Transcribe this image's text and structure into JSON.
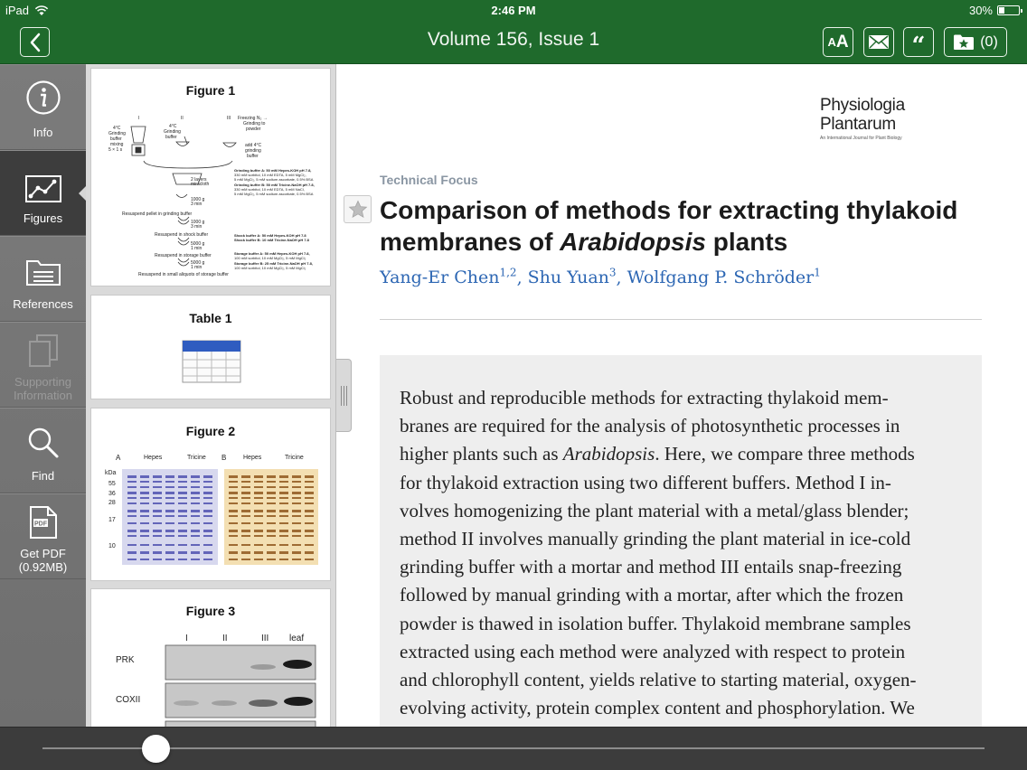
{
  "status_bar": {
    "device": "iPad",
    "time": "2:46 PM",
    "battery": "30%",
    "battery_level": 0.3
  },
  "nav": {
    "title": "Volume 156, Issue 1",
    "text_size_label_small": "A",
    "text_size_label_big": "A",
    "quote_label": "“",
    "saved_count": "(0)",
    "icons": {
      "back": "chevron-left-icon",
      "mail": "mail-icon",
      "saved": "folder-star-icon"
    }
  },
  "sidebar": {
    "items": [
      {
        "label": "Info",
        "icon": "info-icon"
      },
      {
        "label": "Figures",
        "icon": "figures-icon",
        "active": true
      },
      {
        "label": "References",
        "icon": "references-folder-icon"
      },
      {
        "label": "Supporting\nInformation",
        "icon": "supporting-docs-icon",
        "disabled": true
      },
      {
        "label": "Find",
        "icon": "search-icon"
      },
      {
        "label": "Get PDF\n(0.92MB)",
        "icon": "pdf-icon"
      }
    ]
  },
  "thumbnails": [
    {
      "title": "Figure 1",
      "labels": {
        "step1": "I",
        "step2": "II",
        "step3": "III",
        "c1": "4°C",
        "grind1": "Grinding",
        "buffer1": "buffer",
        "mixing": "mixing",
        "time": "5 × 1 s",
        "c2": "4°C",
        "grind2": "Grinding",
        "buffer2": "buffer",
        "freeze": "Freezing N₂ →",
        "grind_to": "Grinding to",
        "powder": "powder",
        "add": "add 4°C",
        "grind3": "grinding",
        "buffer3": "buffer",
        "layers": "2 layers",
        "miracloth": "miracloth",
        "g1000a": "1000 g",
        "min3a": "3 min",
        "resuspend1": "Resuspend pellet in grinding buffer",
        "g1000b": "1000 g",
        "min3b": "3 min",
        "resuspend2": "Resuspend in shock buffer",
        "g5000a": "5000 g",
        "min1a": "1 min",
        "resuspend3": "Resuspend in storage buffer",
        "g5000b": "5000 g",
        "min1b": "1 min",
        "resuspend4": "Resuspend in small aliquots of storage buffer",
        "gb_a": "Grinding buffer A: 50 mM Hepes-KOH pH 7.8,",
        "gb_a2": "330 mM sorbitol, 10 mM EDTA, 5 mM MgCl₂,",
        "gb_a3": "5 mM MgCl₂, 5 mM sodium ascorbate, 0.5% BSA",
        "gb_b": "Grinding buffer B: 50 mM Tricine-NaOH pH 7.8,",
        "gb_b2": "330 mM sorbitol, 10 mM EDTA, 5 mM NaCl,",
        "gb_b3": "5 mM MgCl₂, 5 mM sodium ascorbate, 0.5% BSA",
        "sb_a": "Shock buffer A: 50 mM Hepes-KOH pH 7.8",
        "sb_b": "Shock buffer B: 10 mM Tricine-NaOH pH 7.8",
        "st_a": "Storage buffer A: 50 mM Hepes-KOH pH 7.8,",
        "st_a2": "100 mM sorbitol, 10 mM MgCl₂, 5 mM MgCl₂",
        "st_b": "Storage buffer B: 25 mM Tricine-NaOH pH 7.8,",
        "st_b2": "100 mM sorbitol, 10 mM MgCl₂, 5 mM MgCl₂"
      }
    },
    {
      "title": "Table 1"
    },
    {
      "title": "Figure 2",
      "labels": {
        "panel_a": "A",
        "panel_b": "B",
        "kda": "kDa",
        "hepes_a": "Hepes",
        "tricine_a": "Tricine",
        "hepes_b": "Hepes",
        "tricine_b": "Tricine",
        "m55": "55",
        "m36": "36",
        "m28": "28",
        "m17": "17",
        "m10": "10"
      }
    },
    {
      "title": "Figure 3",
      "labels": {
        "col1": "I",
        "col2": "II",
        "col3": "III",
        "col4": "leaf",
        "row1": "PRK",
        "row2": "COXII"
      }
    }
  ],
  "article": {
    "journal_line1": "Physiologia",
    "journal_line2": "Plantarum",
    "journal_tagline": "An International Journal for Plant Biology",
    "kicker": "Technical Focus",
    "title_part1": "Comparison of methods for extracting thylakoid membranes of ",
    "title_italic": "Arabidopsis",
    "title_part2": " plants",
    "authors": [
      {
        "name": "Yang-Er Chen",
        "sup": "1,2",
        "sep": ", "
      },
      {
        "name": "Shu Yuan",
        "sup": "3",
        "sep": ", "
      },
      {
        "name": "Wolfgang P. Schröder",
        "sup": "1",
        "sep": ""
      }
    ],
    "abstract_lines": [
      "Robust and reproducible methods for extracting thylakoid mem-",
      "branes are required for the analysis of photosynthetic processes in",
      "higher plants such as |Arabidopsis|. Here, we compare three methods",
      "for thylakoid extraction using two different buffers. Method I in-",
      "volves homogenizing the plant material with a metal/glass blender;",
      "method II involves manually grinding the plant material in ice-cold",
      "grinding buffer with a mortar and method III entails snap-freezing",
      "followed by manual grinding with a mortar, after which the frozen",
      "powder is thawed in isolation buffer. Thylakoid membrane samples",
      "extracted using each method were analyzed with respect to protein",
      "and chlorophyll content, yields relative to starting material, oxygen-",
      "evolving activity, protein complex content and phosphorylation. We"
    ],
    "page_indicator": {
      "pages": 7,
      "current": 1
    }
  },
  "bottom_slider": {
    "position": 0.12
  }
}
